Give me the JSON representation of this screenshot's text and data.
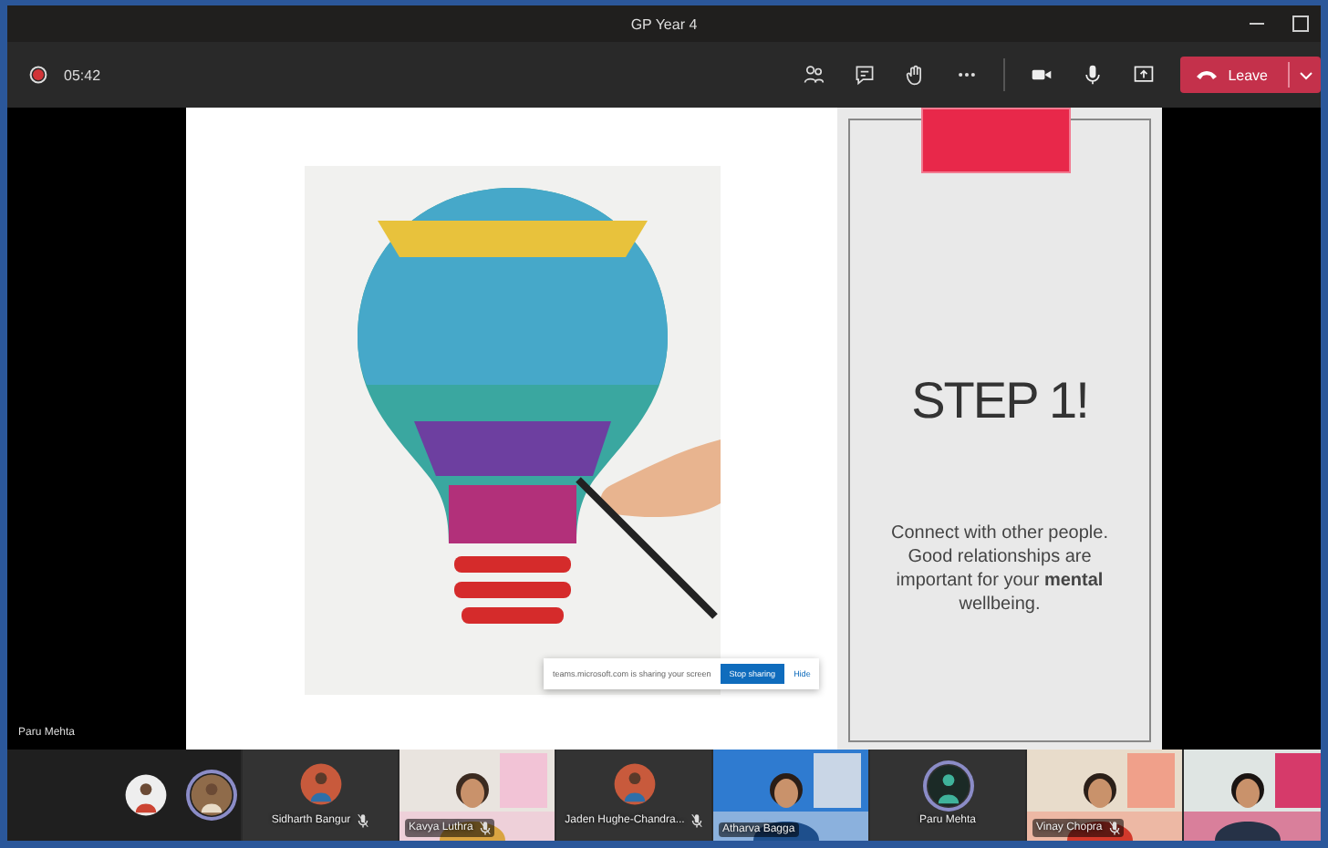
{
  "window": {
    "title": "GP Year 4"
  },
  "call": {
    "recording": true,
    "duration": "05:42",
    "leave_label": "Leave"
  },
  "slide": {
    "heading": "STEP 1!",
    "body": "Connect with other people. Good relationships are important for your **mental** wellbeing."
  },
  "share_notice": {
    "message": "teams.microsoft.com is sharing your screen",
    "stop_button": "Stop sharing",
    "hide_link": "Hide"
  },
  "presenter_label": "Paru Mehta",
  "participants": [
    {
      "kind": "avatars",
      "avatars": [
        {
          "speaking": false
        },
        {
          "speaking": true
        }
      ]
    },
    {
      "kind": "avatar",
      "name": "Sidharth Bangur",
      "muted": true,
      "speaking": false
    },
    {
      "kind": "video",
      "name": "Kavya Luthra",
      "muted": true
    },
    {
      "kind": "avatar",
      "name": "Jaden Hughe-Chandra...",
      "muted": true,
      "speaking": false
    },
    {
      "kind": "video",
      "name": "Atharva Bagga",
      "muted": false
    },
    {
      "kind": "avatar",
      "name": "Paru Mehta",
      "muted": false,
      "speaking": true
    },
    {
      "kind": "video",
      "name": "Vinay Chopra",
      "muted": true
    },
    {
      "kind": "video"
    }
  ]
}
